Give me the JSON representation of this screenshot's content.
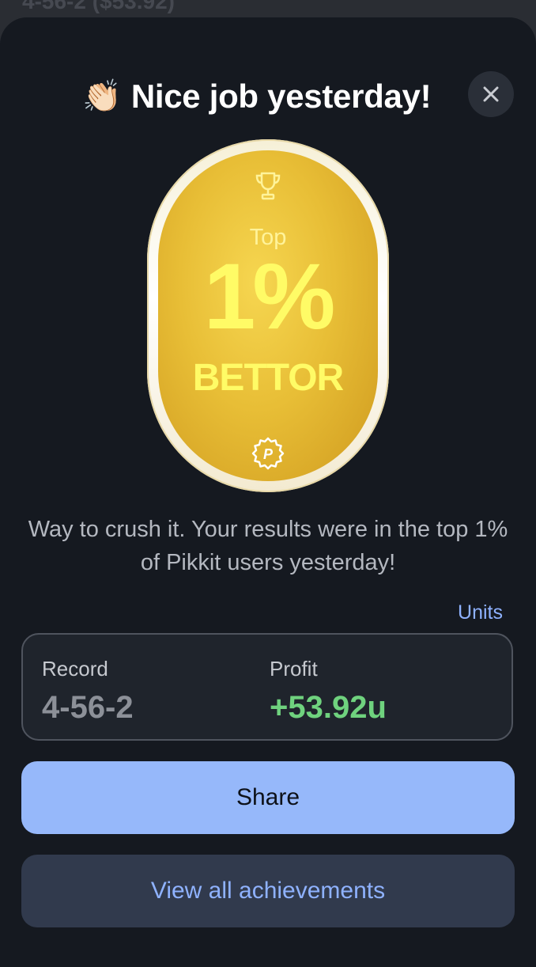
{
  "backdrop": {
    "partial_text": "4-56-2 ($53.92)"
  },
  "header": {
    "emoji": "👏🏻",
    "title": "Nice job yesterday!",
    "close_icon": "close-icon"
  },
  "badge": {
    "icon_top": "trophy-icon",
    "top_label": "Top",
    "percent": "1%",
    "label": "BETTOR",
    "icon_bottom": "pikkit-seal-icon",
    "seal_letter": "P"
  },
  "message": "Way to crush it. Your results were in the top 1% of Pikkit users yesterday!",
  "units_toggle": "Units",
  "stats": {
    "record_label": "Record",
    "record_value": "4-56-2",
    "profit_label": "Profit",
    "profit_value": "+53.92u"
  },
  "buttons": {
    "share": "Share",
    "view_achievements": "View all achievements"
  },
  "colors": {
    "sheet_bg": "#151920",
    "accent_blue": "#96b8fa",
    "link_blue": "#8fb2ff",
    "profit_green": "#6fd27e",
    "record_gray": "#8c9098",
    "badge_gold": "#e8be36",
    "badge_text": "#fffb66"
  }
}
